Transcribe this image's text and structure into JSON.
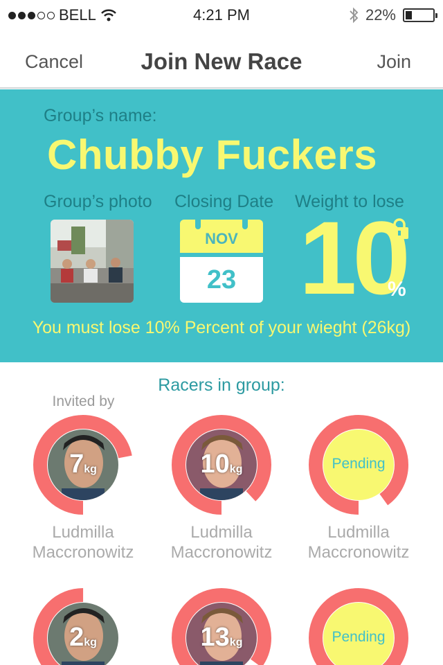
{
  "status_bar": {
    "carrier": "BELL",
    "time": "4:21 PM",
    "battery": "22%",
    "battery_level": 0.22
  },
  "nav": {
    "cancel": "Cancel",
    "title": "Join New Race",
    "join": "Join"
  },
  "group": {
    "name_label": "Group’s name:",
    "name": "Chubby Fuckers",
    "photo_label": "Group’s photo",
    "closing_label": "Closing Date",
    "closing_month": "NOV",
    "closing_day": "23",
    "weight_label": "Weight to lose",
    "weight_value": "10",
    "weight_unit": "%",
    "note": "You must lose 10% Percent of your wieght (26kg)"
  },
  "racers": {
    "title": "Racers in group:",
    "invited_by": "Invited by",
    "unit": "kg",
    "pending_label": "Pending",
    "items": [
      {
        "kg": "7",
        "name": "Ludmilla Maccronowitz",
        "progress": 0.72,
        "pending": false
      },
      {
        "kg": "10",
        "name": "Ludmilla Maccronowitz",
        "progress": 0.88,
        "pending": false
      },
      {
        "kg": "",
        "name": "Ludmilla Maccronowitz",
        "progress": 0.9,
        "pending": true
      },
      {
        "kg": "2",
        "name": "",
        "progress": 0.5,
        "pending": false
      },
      {
        "kg": "13",
        "name": "",
        "progress": 0.85,
        "pending": false
      },
      {
        "kg": "",
        "name": "",
        "progress": 0.9,
        "pending": true
      }
    ]
  },
  "colors": {
    "teal": "#41c0c8",
    "yellow": "#f8f871",
    "coral": "#f76f6f"
  }
}
